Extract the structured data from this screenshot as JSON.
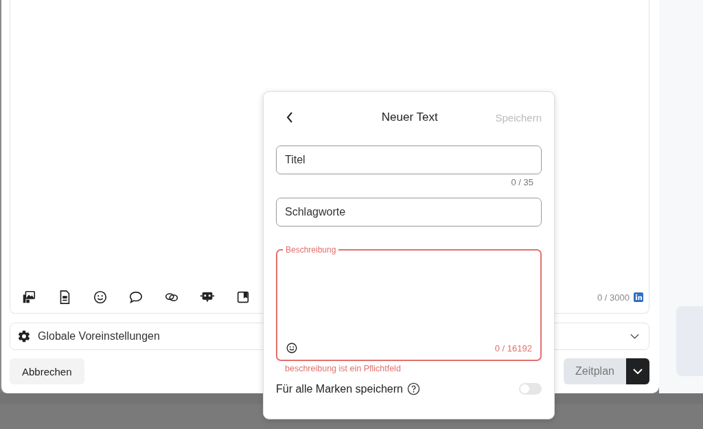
{
  "editor": {
    "counter": "0 / 3000"
  },
  "global_settings": {
    "label": "Globale Voreinstellungen",
    "expanded": false
  },
  "cancel_button": {
    "label": "Abbrechen"
  },
  "schedule_button": {
    "label": "Zeitplan",
    "disabled": true
  },
  "dialog": {
    "title": "Neuer Text",
    "save": {
      "label": "Speichern",
      "disabled": true
    },
    "fields": [
      {
        "kind": "input",
        "placeholder": "Titel",
        "counter": "0 / 35"
      },
      {
        "kind": "input",
        "placeholder": "Schlagworte"
      },
      {
        "kind": "textarea",
        "label": "Beschreibung",
        "counter": "0 / 16192",
        "error": "beschreibung ist ein Pflichtfeld"
      }
    ],
    "toggle": {
      "label": "Für alle Marken speichern",
      "on": false
    }
  }
}
